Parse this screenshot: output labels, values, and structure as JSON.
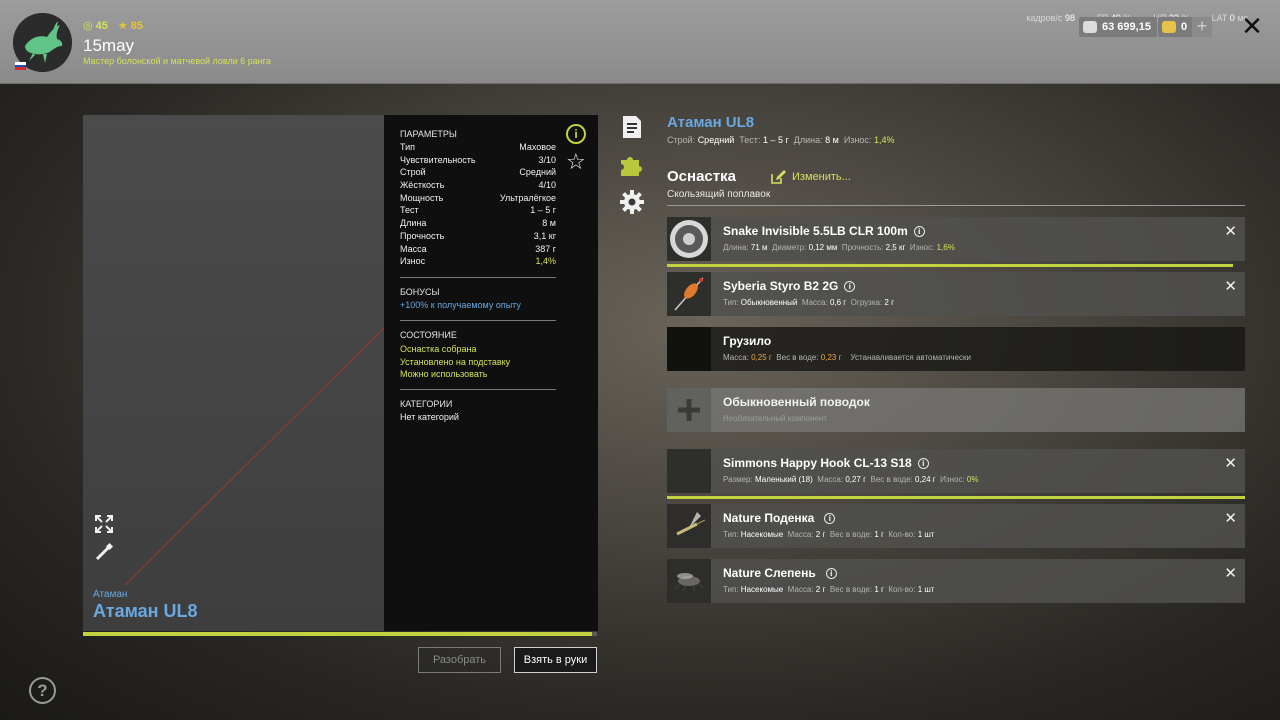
{
  "player": {
    "level": "45",
    "stars": "85",
    "name": "15may",
    "rank": "Мастер болонской и матчевой ловли 6 ранга"
  },
  "perf": {
    "fps_label": "кадров/с",
    "fps": "98",
    "gpu_label": "ГП",
    "gpu": "49",
    "cpu_label": "ЦП",
    "cpu": "33",
    "lat_label": "LAT",
    "lat": "0"
  },
  "currency": {
    "silver": "63 699,15",
    "gold": "0"
  },
  "rod": {
    "brand": "Атаман",
    "name": "Атаман UL8",
    "sub_stroy_label": "Строй:",
    "sub_stroy": "Средний",
    "sub_test_label": "Тест:",
    "sub_test": "1 – 5 г",
    "sub_len_label": "Длина:",
    "sub_len": "8 м",
    "sub_wear_label": "Износ:",
    "sub_wear": "1,4%",
    "durability_pct": 99
  },
  "params": {
    "title": "ПАРАМЕТРЫ",
    "rows": [
      {
        "k": "Тип",
        "v": "Маховое"
      },
      {
        "k": "Чувствительность",
        "v": "3/10"
      },
      {
        "k": "Строй",
        "v": "Средний"
      },
      {
        "k": "Жёсткость",
        "v": "4/10"
      },
      {
        "k": "Мощность",
        "v": "Ультралёгкое"
      },
      {
        "k": "Тест",
        "v": "1 – 5 г"
      },
      {
        "k": "Длина",
        "v": "8 м"
      },
      {
        "k": "Прочность",
        "v": "3,1 кг"
      },
      {
        "k": "Масса",
        "v": "387 г"
      },
      {
        "k": "Износ",
        "v": "1,4%"
      }
    ],
    "bonus_title": "БОНУСЫ",
    "bonus": "+100% к получаемому опыту",
    "state_title": "СОСТОЯНИЕ",
    "state": [
      "Оснастка собрана",
      "Установлено на подставку",
      "Можно использовать"
    ],
    "cat_title": "КАТЕГОРИИ",
    "cat": "Нет категорий"
  },
  "buttons": {
    "disassemble": "Разобрать",
    "take": "Взять в руки"
  },
  "rig": {
    "title": "Оснастка",
    "edit": "Изменить...",
    "type": "Скользящий поплавок"
  },
  "slots": [
    {
      "name": "Snake Invisible 5.5LB CLR 100m",
      "info": [
        [
          "Длина:",
          "71 м"
        ],
        [
          "Диаметр:",
          "0,12 мм"
        ],
        [
          "Прочность:",
          "2,5 кг"
        ],
        [
          "Износ:",
          "1,6%"
        ]
      ],
      "durability_pct": 98
    },
    {
      "name": "Syberia Styro B2 2G",
      "info": [
        [
          "Тип:",
          "Обыкновенный"
        ],
        [
          "Масса:",
          "0,6 г"
        ],
        [
          "Огрузка:",
          "2 г"
        ]
      ]
    },
    {
      "name": "Грузило",
      "info": [
        [
          "Масса:",
          "0,25 г"
        ],
        [
          "Вес в воде:",
          "0,23 г"
        ]
      ],
      "auto": "Устанавливается автоматически"
    },
    {
      "name": "Обыкновенный поводок",
      "optional": "Необязательный компонент"
    },
    {
      "name": "Simmons Happy Hook CL-13 S18",
      "info": [
        [
          "Размер:",
          "Маленький (18)"
        ],
        [
          "Масса:",
          "0,27 г"
        ],
        [
          "Вес в воде:",
          "0,24 г"
        ],
        [
          "Износ:",
          "0%"
        ]
      ],
      "durability_pct": 100
    },
    {
      "name": "Nature Поденка",
      "info": [
        [
          "Тип:",
          "Насекомые"
        ],
        [
          "Масса:",
          "2 г"
        ],
        [
          "Вес в воде:",
          "1 г"
        ],
        [
          "Кол-во:",
          "1 шт"
        ]
      ]
    },
    {
      "name": "Nature Слепень",
      "info": [
        [
          "Тип:",
          "Насекомые"
        ],
        [
          "Масса:",
          "2 г"
        ],
        [
          "Вес в воде:",
          "1 г"
        ],
        [
          "Кол-во:",
          "1 шт"
        ]
      ]
    }
  ],
  "colors": {
    "accent": "#d4e25a",
    "blue": "#6aa8e0",
    "orange": "#e8a63a"
  }
}
